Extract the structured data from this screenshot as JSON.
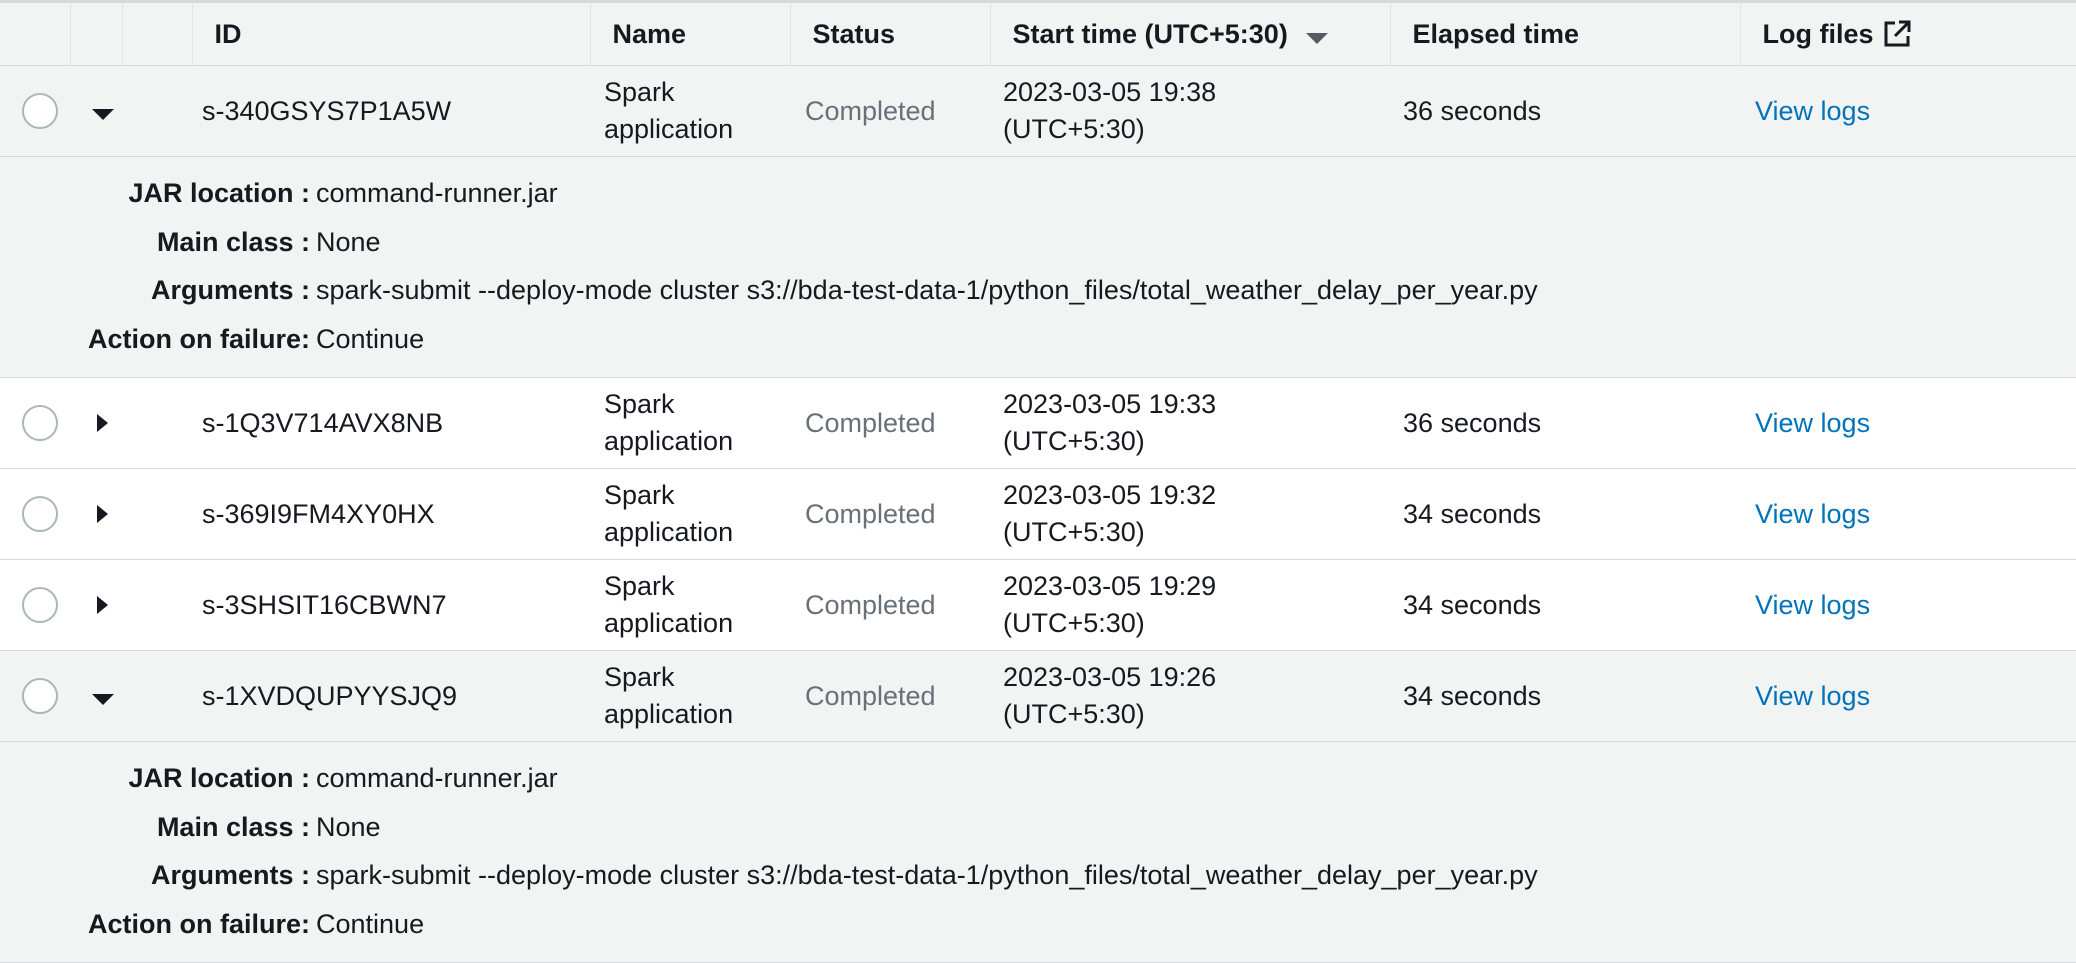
{
  "columns": {
    "id": "ID",
    "name": "Name",
    "status": "Status",
    "start_time": "Start time (UTC+5:30)",
    "elapsed": "Elapsed time",
    "log_files": "Log files"
  },
  "icons": {
    "sort": "sort-descending-icon",
    "external": "external-link-icon",
    "expand": "caret-right-icon",
    "collapse": "caret-down-icon"
  },
  "colors": {
    "link": "#0073bb",
    "status": "#687078",
    "expanded_bg": "#f2f3f3"
  },
  "detail_labels": {
    "jar": "JAR location :",
    "main_class": "Main class :",
    "args": "Arguments :",
    "action": "Action on failure:"
  },
  "steps": [
    {
      "id": "s-340GSYS7P1A5W",
      "name": "Spark application",
      "status": "Completed",
      "start_line1": "2023-03-05 19:38",
      "start_line2": "(UTC+5:30)",
      "elapsed": "36 seconds",
      "log_link": "View logs",
      "expanded": true,
      "details": {
        "jar": "command-runner.jar",
        "main_class": "None",
        "args": "spark-submit --deploy-mode cluster s3://bda-test-data-1/python_files/total_weather_delay_per_year.py",
        "action": "Continue"
      }
    },
    {
      "id": "s-1Q3V714AVX8NB",
      "name": "Spark application",
      "status": "Completed",
      "start_line1": "2023-03-05 19:33",
      "start_line2": "(UTC+5:30)",
      "elapsed": "36 seconds",
      "log_link": "View logs",
      "expanded": false
    },
    {
      "id": "s-369I9FM4XY0HX",
      "name": "Spark application",
      "status": "Completed",
      "start_line1": "2023-03-05 19:32",
      "start_line2": "(UTC+5:30)",
      "elapsed": "34 seconds",
      "log_link": "View logs",
      "expanded": false
    },
    {
      "id": "s-3SHSIT16CBWN7",
      "name": "Spark application",
      "status": "Completed",
      "start_line1": "2023-03-05 19:29",
      "start_line2": "(UTC+5:30)",
      "elapsed": "34 seconds",
      "log_link": "View logs",
      "expanded": false
    },
    {
      "id": "s-1XVDQUPYYSJQ9",
      "name": "Spark application",
      "status": "Completed",
      "start_line1": "2023-03-05 19:26",
      "start_line2": "(UTC+5:30)",
      "elapsed": "34 seconds",
      "log_link": "View logs",
      "expanded": true,
      "details": {
        "jar": "command-runner.jar",
        "main_class": "None",
        "args": "spark-submit --deploy-mode cluster s3://bda-test-data-1/python_files/total_weather_delay_per_year.py",
        "action": "Continue"
      }
    }
  ]
}
